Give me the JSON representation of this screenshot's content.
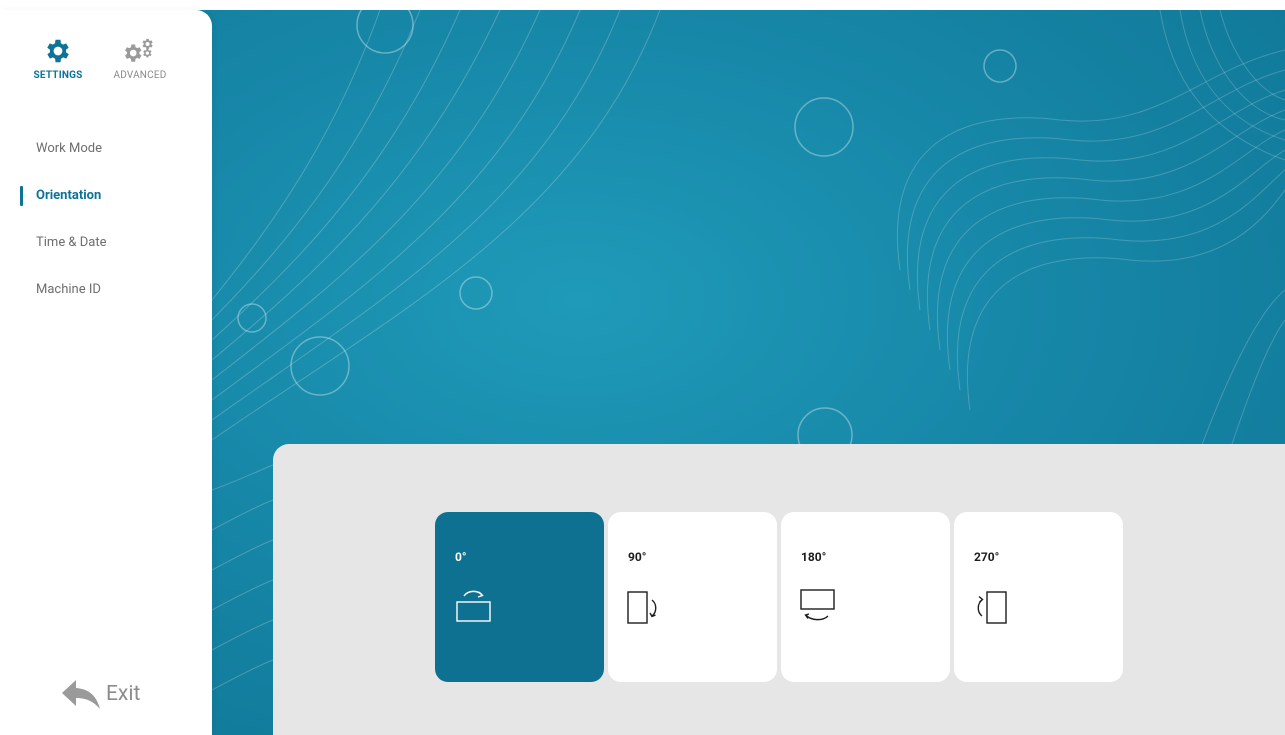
{
  "sidebar": {
    "tabs": [
      {
        "label": "SETTINGS",
        "icon": "gear-icon",
        "active": true
      },
      {
        "label": "ADVANCED",
        "icon": "gears-icon",
        "active": false
      }
    ],
    "items": [
      {
        "label": "Work Mode",
        "active": false
      },
      {
        "label": "Orientation",
        "active": true
      },
      {
        "label": "Time & Date",
        "active": false
      },
      {
        "label": "Machine ID",
        "active": false
      }
    ],
    "exit_label": "Exit"
  },
  "orientation": {
    "options": [
      {
        "label": "0°",
        "icon": "rotate-landscape-icon",
        "selected": true
      },
      {
        "label": "90°",
        "icon": "rotate-portrait-cw-icon",
        "selected": false
      },
      {
        "label": "180°",
        "icon": "rotate-landscape-flip-icon",
        "selected": false
      },
      {
        "label": "270°",
        "icon": "rotate-portrait-ccw-icon",
        "selected": false
      }
    ]
  },
  "colors": {
    "accent": "#0e7396",
    "selected_card": "#0f7192",
    "background_teal": "#1787a8",
    "panel": "#e6e6e6"
  }
}
